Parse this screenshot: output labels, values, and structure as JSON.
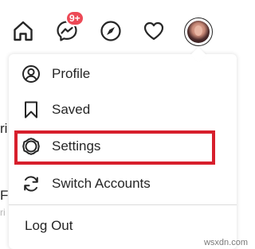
{
  "nav": {
    "messages_badge": "9+"
  },
  "menu": {
    "items": [
      {
        "label": "Profile",
        "icon": "profile-icon"
      },
      {
        "label": "Saved",
        "icon": "bookmark-icon"
      },
      {
        "label": "Settings",
        "icon": "gear-icon"
      },
      {
        "label": "Switch Accounts",
        "icon": "switch-accounts-icon"
      }
    ],
    "logout_label": "Log Out"
  },
  "background": {
    "fragment_1": "ri",
    "fragment_2": "Fo",
    "fragment_3": "ri"
  },
  "colors": {
    "badge": "#ed4956",
    "highlight": "#d71f2c",
    "text": "#262626",
    "divider": "#dbdbdb"
  },
  "watermark": "wsxdn.com"
}
